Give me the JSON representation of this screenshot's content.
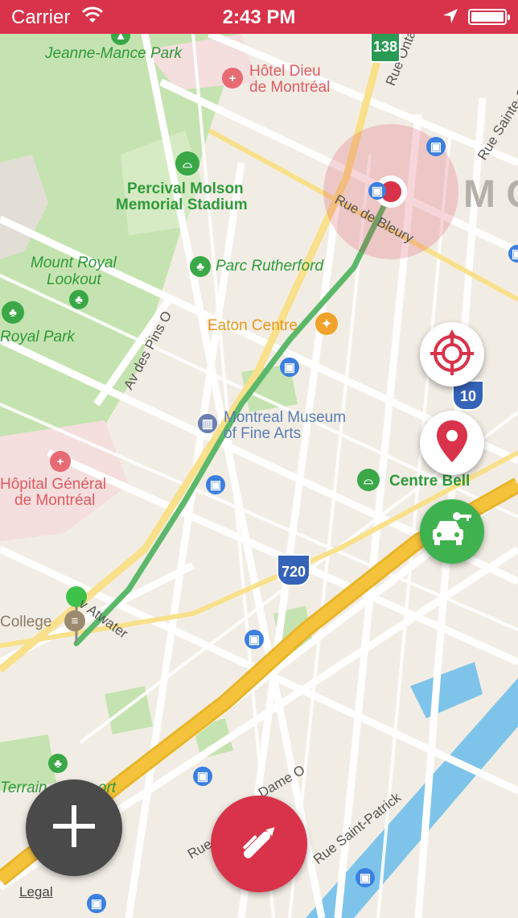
{
  "status_bar": {
    "carrier": "Carrier",
    "time": "2:43 PM",
    "wifi_icon": "wifi-icon",
    "location_icon": "location-arrow-icon",
    "battery_icon": "battery-full-icon",
    "background_color": "#d8334a"
  },
  "map": {
    "places": {
      "jeanne_mance_park": "Jeanne-Mance Park",
      "hotel_dieu_line1": "Hôtel Dieu",
      "hotel_dieu_line2": "de Montréal",
      "percival_line1": "Percival Molson",
      "percival_line2": "Memorial Stadium",
      "mount_royal_line1": "Mount Royal",
      "mount_royal_line2": "Lookout",
      "parc_rutherford": "Parc Rutherford",
      "royal_park": "Royal Park",
      "eaton_centre": "Eaton Centre",
      "museum_line1": "Montreal Museum",
      "museum_line2": "of Fine Arts",
      "hopital_line1": "Hôpital Général",
      "hopital_line2": "de Montréal",
      "centre_bell": "Centre Bell",
      "college": "College",
      "terrain": "Terrain",
      "terrain_rest": "ort",
      "city_letters": "M C"
    },
    "streets": {
      "rue_ontario": "Rue Ontario",
      "rue_sainte": "Rue Sainte-C",
      "rue_de_bleury": "Rue de Bleury",
      "av_des_pins": "Av des Pins O",
      "av_atwater": "v Atwater",
      "rue_notre_dame": "Rue N",
      "dame_o": "Dame O",
      "rue_saint_patrick": "Rue Saint-Patrick"
    },
    "shields": {
      "route_138": "138",
      "route_10": "10",
      "route_720": "720"
    },
    "colors": {
      "route_line": "#5cb86a",
      "destination": "#d8334a",
      "highway": "#f5c33b",
      "water": "#7ec4ea",
      "park": "#c5e3b0"
    },
    "legal": "Legal"
  },
  "actions": {
    "recenter_icon": "crosshair-compass-icon",
    "pin_icon": "map-pin-icon",
    "car_service_icon": "car-key-icon",
    "add_icon": "plus-icon",
    "edit_icon": "pen-icon"
  }
}
